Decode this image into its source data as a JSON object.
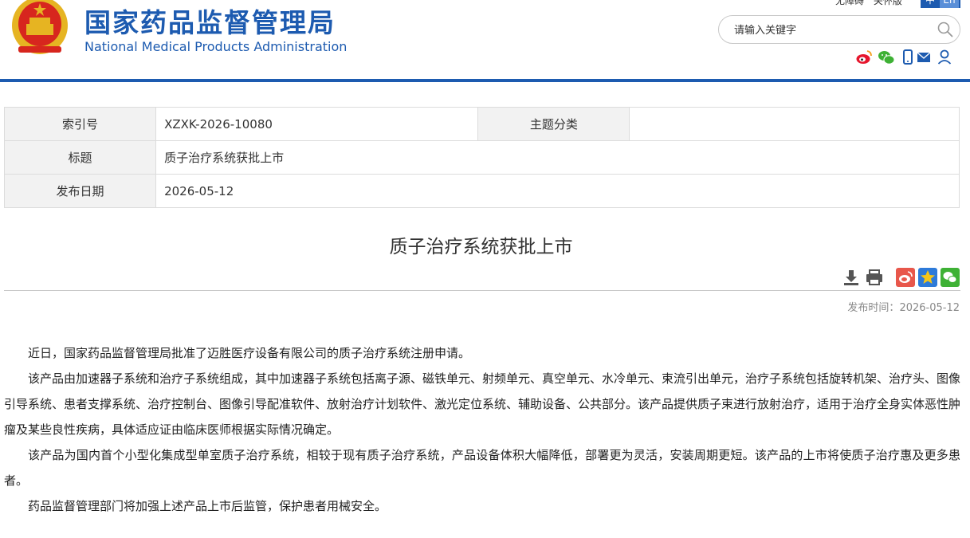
{
  "header": {
    "title_cn": "国家药品监督管理局",
    "title_en": "National Medical Products Administration",
    "top_links": [
      "无障碍",
      "关怀版"
    ],
    "lang_cn": "中",
    "lang_en": "En",
    "search_placeholder": "请输入关键字",
    "share_icons": [
      "weibo-icon",
      "wechat-icon",
      "mobile-icon",
      "mail-icon",
      "user-icon"
    ],
    "accent_color": "#1d5bb0"
  },
  "info_table": {
    "index_label": "索引号",
    "index_value": "XZXK-2026-10080",
    "category_label": "主题分类",
    "category_value": "",
    "title_label": "标题",
    "title_value": "质子治疗系统获批上市",
    "date_label": "发布日期",
    "date_value": "2026-05-12"
  },
  "article": {
    "title": "质子治疗系统获批上市",
    "tool_icons": [
      "download-icon",
      "print-icon",
      "weibo-share-icon",
      "favorite-icon",
      "wechat-share-icon"
    ],
    "pub_time_label": "发布时间：",
    "pub_time_value": "2026-05-12",
    "paragraphs": [
      "近日，国家药品监督管理局批准了迈胜医疗设备有限公司的质子治疗系统注册申请。",
      "该产品由加速器子系统和治疗子系统组成，其中加速器子系统包括离子源、磁铁单元、射频单元、真空单元、水冷单元、束流引出单元，治疗子系统包括旋转机架、治疗头、图像引导系统、患者支撑系统、治疗控制台、图像引导配准软件、放射治疗计划软件、激光定位系统、辅助设备、公共部分。该产品提供质子束进行放射治疗，适用于治疗全身实体恶性肿瘤及某些良性疾病，具体适应证由临床医师根据实际情况确定。",
      "该产品为国内首个小型化集成型单室质子治疗系统，相较于现有质子治疗系统，产品设备体积大幅降低，部署更为灵活，安装周期更短。该产品的上市将使质子治疗惠及更多患者。",
      "药品监督管理部门将加强上述产品上市后监管，保护患者用械安全。"
    ]
  }
}
